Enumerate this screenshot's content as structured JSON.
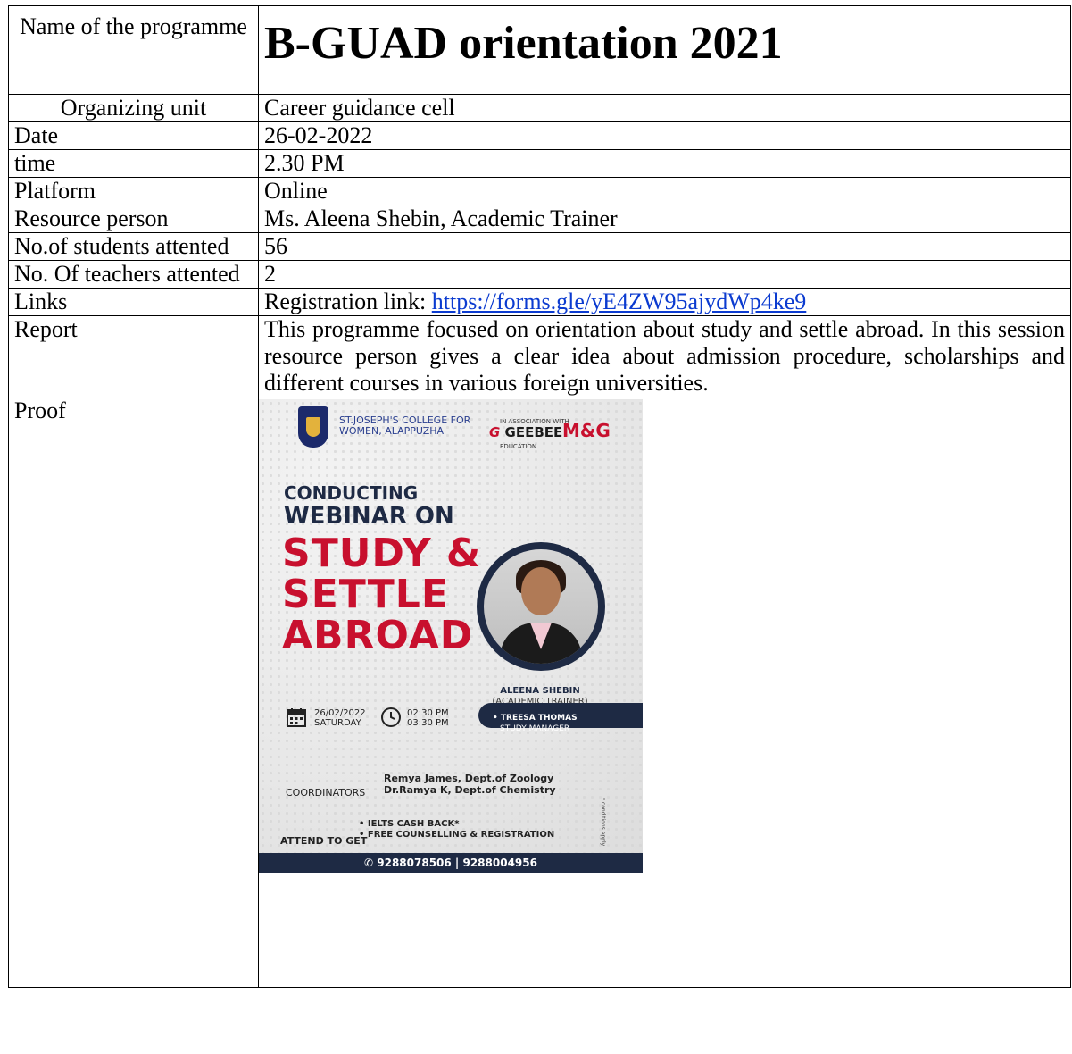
{
  "title_row": {
    "label": "Name of the programme",
    "value": "B-GUAD orientation 2021"
  },
  "rows": {
    "organizing_unit": {
      "label": "Organizing unit",
      "value": "Career guidance cell"
    },
    "date": {
      "label": "Date",
      "value": "26-02-2022"
    },
    "time": {
      "label": "time",
      "value": "2.30 PM"
    },
    "platform": {
      "label": "Platform",
      "value": "Online"
    },
    "resource_person": {
      "label": "Resource person",
      "value": "Ms. Aleena Shebin, Academic Trainer"
    },
    "students": {
      "label": "No.of students attented",
      "value": "56"
    },
    "teachers": {
      "label": "No. Of teachers attented",
      "value": "2"
    },
    "links": {
      "label": "Links",
      "prefix": "Registration link: ",
      "url": "https://forms.gle/yE4ZW95ajydWp4ke9"
    },
    "report": {
      "label": "Report",
      "value": "This programme focused on orientation about study and settle abroad. In this session resource person gives a clear idea about admission procedure, scholarships and different courses in various foreign universities."
    },
    "proof": {
      "label": "Proof"
    }
  },
  "poster": {
    "college": "ST.JOSEPH'S COLLEGE FOR WOMEN, ALAPPUZHA",
    "association": "IN ASSOCIATION WITH",
    "partner1": "GEEBEE",
    "partner1_sub": "EDUCATION",
    "partner2": "M&G",
    "conducting": "CONDUCTING",
    "webinar_on": "WEBINAR ON",
    "headline1": "STUDY &",
    "headline2": "SETTLE",
    "headline3": "ABROAD",
    "speaker_name": "ALEENA SHEBIN",
    "speaker_role": "(ACADEMIC TRAINER)",
    "date": "26/02/2022",
    "day": "SATURDAY",
    "time_start": "02:30 PM",
    "time_end": "03:30 PM",
    "manager_name": "• TREESA THOMAS",
    "manager_role": "STUDY MANAGER",
    "coordinators_label": "COORDINATORS",
    "coordinator1": "Remya James, Dept.of Zoology",
    "coordinator2": "Dr.Ramya K, Dept.of Chemistry",
    "attend_label": "ATTEND TO GET",
    "benefit1": "• IELTS CASH BACK*",
    "benefit2": "• FREE COUNSELLING & REGISTRATION",
    "conditions": "* conditions apply",
    "phones": "✆ 9288078506 | 9288004956"
  }
}
